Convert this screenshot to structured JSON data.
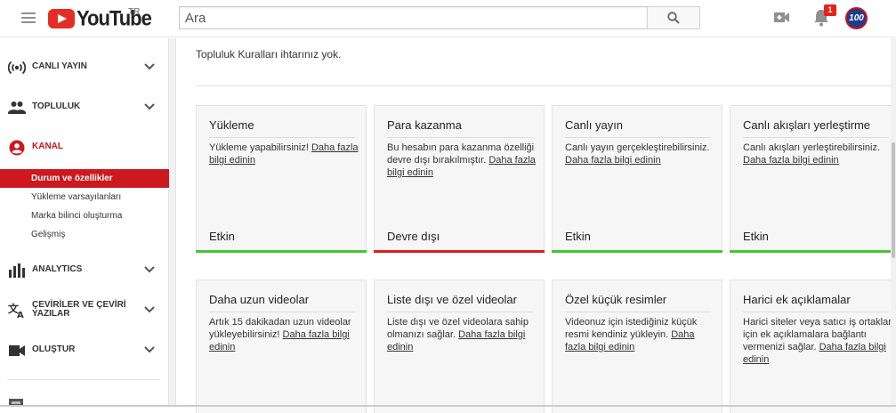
{
  "header": {
    "logo_text": "YouTube",
    "country": "TR",
    "search_placeholder": "Ara",
    "notification_count": "1",
    "avatar_text": "100"
  },
  "sidebar": {
    "items": [
      {
        "label": "CANLI YAYIN",
        "icon": "broadcast-icon"
      },
      {
        "label": "TOPLULUK",
        "icon": "people-icon"
      },
      {
        "label": "KANAL",
        "icon": "account-icon"
      },
      {
        "label": "ANALYTICS",
        "icon": "bar-chart-icon"
      },
      {
        "label": "ÇEVİRİLER VE ÇEVİRİ YAZILAR",
        "icon": "translate-icon"
      },
      {
        "label": "OLUŞTUR",
        "icon": "video-camera-icon"
      }
    ],
    "kanal_sub": [
      {
        "label": "Durum ve özellikler",
        "active": true
      },
      {
        "label": "Yükleme varsayılanları"
      },
      {
        "label": "Marka bilinci oluşturma"
      },
      {
        "label": "Gelişmiş"
      }
    ]
  },
  "main": {
    "notice": "Topluluk Kuralları ihtarınız yok.",
    "cards": [
      {
        "title": "Yükleme",
        "desc": "Yükleme yapabilirsiniz!",
        "link": "Daha fazla bilgi edinin",
        "status": "Etkin",
        "bar_color": "#45c432"
      },
      {
        "title": "Para kazanma",
        "desc": "Bu hesabın para kazanma özelliği devre dışı bırakılmıştır.",
        "link": "Daha fazla bilgi edinin",
        "status": "Devre dışı",
        "bar_color": "#d6201f"
      },
      {
        "title": "Canlı yayın",
        "desc": "Canlı yayın gerçekleştirebilirsiniz.",
        "link": "Daha fazla bilgi edinin",
        "status": "Etkin",
        "bar_color": "#45c432"
      },
      {
        "title": "Canlı akışları yerleştirme",
        "desc": "Canlı akışları yerleştirebilirsiniz.",
        "link": "Daha fazla bilgi edinin",
        "status": "Etkin",
        "bar_color": "#45c432"
      },
      {
        "title": "Daha uzun videolar",
        "desc": "Artık 15 dakikadan uzun videolar yükleyebilirsiniz!",
        "link": "Daha fazla bilgi edinin"
      },
      {
        "title": "Liste dışı ve özel videolar",
        "desc": "Liste dışı ve özel videolara sahip olmanızı sağlar.",
        "link": "Daha fazla bilgi edinin"
      },
      {
        "title": "Özel küçük resimler",
        "desc": "Videonuz için istediğiniz küçük resmi kendiniz yükleyin.",
        "link": "Daha fazla bilgi edinin"
      },
      {
        "title": "Harici ek açıklamalar",
        "desc": "Harici siteler veya satıcı iş ortakları için ek açıklamalara bağlantı vermenizi sağlar.",
        "link": "Daha fazla bilgi edinin"
      }
    ]
  }
}
